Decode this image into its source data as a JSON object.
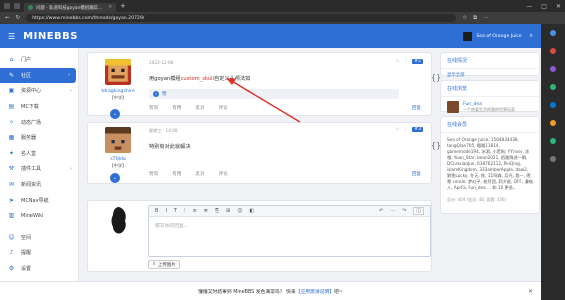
{
  "browser": {
    "tab_title": "问题 - 轨道科技goyan模组跟踪...",
    "url": "https://www.minebbs.com/threads/goyan.20729/",
    "window_controls": [
      "—",
      "□",
      "✕"
    ]
  },
  "header": {
    "logo": "MINEBBS",
    "user_name": "Sea of Orange Juice"
  },
  "sidebar": {
    "items": [
      {
        "label": "门户",
        "icon": "⌂",
        "chev": ""
      },
      {
        "label": "社区",
        "icon": "✎",
        "chev": "›"
      },
      {
        "label": "资源中心",
        "icon": "▣",
        "chev": "›"
      },
      {
        "label": "MC下载",
        "icon": "▤",
        "chev": ""
      },
      {
        "label": "动态广场",
        "icon": "✧",
        "chev": ""
      },
      {
        "label": "服务器",
        "icon": "▦",
        "chev": ""
      },
      {
        "label": "名人堂",
        "icon": "✦",
        "chev": ""
      },
      {
        "label": "插件工具",
        "icon": "⚒",
        "chev": "›"
      },
      {
        "label": "新闻资讯",
        "icon": "✉",
        "chev": ""
      },
      {
        "label": "MCNav导航",
        "icon": "➤",
        "chev": ""
      },
      {
        "label": "MineWiki",
        "icon": "▥",
        "chev": ""
      },
      {
        "label": "空间",
        "icon": "☺",
        "chev": ""
      },
      {
        "label": "提醒",
        "icon": "♪",
        "chev": ""
      },
      {
        "label": "设置",
        "icon": "⚙",
        "chev": ""
      }
    ]
  },
  "posts": [
    {
      "username": "tdragkingshire",
      "user_title": "【中学】",
      "date": "2023-12-08",
      "body_prefix": "用goyan模组",
      "body_highlight": "custom_skull",
      "body_suffix": "自定义头颅法如",
      "reaction_count": "赞",
      "actions": [
        "赞同",
        "有用",
        "反对",
        "评论"
      ],
      "reply": "回复",
      "tools": [
        "☆",
        "⋮"
      ],
      "post_no": "#2"
    },
    {
      "username": "sTfdda",
      "user_title": "【中学】",
      "date": "星期三 · 14:08",
      "body": "特别有对此就解决",
      "actions": [
        "赞同",
        "有用",
        "反对",
        "评论"
      ],
      "reply": "回复",
      "tools": [
        "☆",
        "⋮"
      ],
      "post_no": "#3"
    }
  ],
  "editor": {
    "toolbar": [
      "B",
      "I",
      "T",
      "⁝",
      "≡",
      "≣",
      "⎘",
      "⊞",
      "☺",
      "◧",
      "↶",
      "···",
      "↷"
    ],
    "placeholder": "撰写你的回复...",
    "upload_label": "上传图片",
    "preview_icon": "◫"
  },
  "right": {
    "box1_title": "在线情况",
    "box1_link": "显示全部",
    "box2_title": "在线浏览",
    "viewer_name": "Fun_dea",
    "viewer_text": "一个热爱生活的我的世界玩家",
    "box3_title": "在线会员",
    "online_list": "Sea of Orange Juice, 1564834438, tangQian705, 嗷嗷11814, gamemode194, 冰酒, 小黑狗, YYriver, 冻哦, Yuan_Star, bean2021, 陌路殊途一瞬, DCLeixiaoJun, 638762112, PinQing, islamKingdom, 333amberApple, daw2, 狼鱼Lucky, 冬天, 枕, 11阿森, 月光, 我一, 嗯嗯 cerole, 梦幻子, 枝芽团, 莉夕星, OFF, 漫喵人, AprFa, Fun_dea ... 和 10 更多。",
    "online_stats": "总计: 404 (会员: 48, 游客: 356)"
  },
  "notice": {
    "text": "懂懂又时结果到 MineBBS 发色满常吗？ 快来",
    "link": "【应用需请说明】",
    "after": "吧~",
    "close": "✕"
  }
}
